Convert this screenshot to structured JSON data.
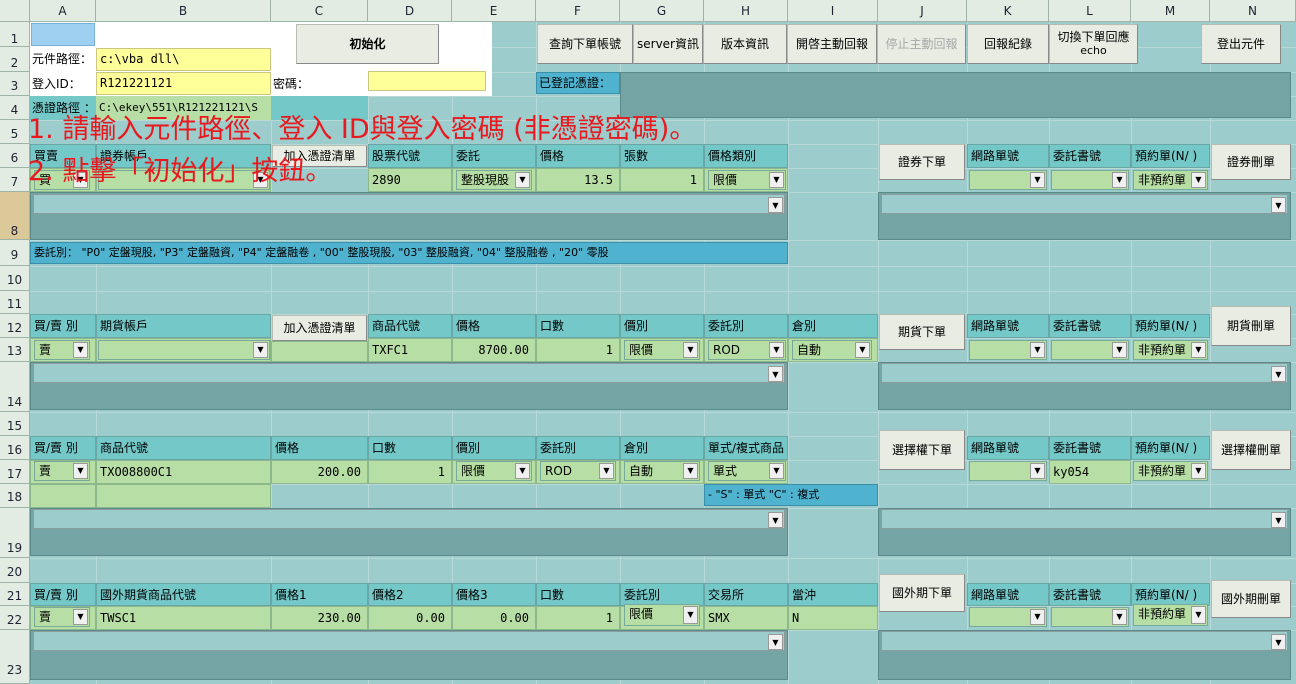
{
  "columns": [
    "A",
    "B",
    "C",
    "D",
    "E",
    "F",
    "G",
    "H",
    "I",
    "J",
    "K",
    "L",
    "M",
    "N"
  ],
  "rows": [
    "1",
    "2",
    "3",
    "4",
    "5",
    "6",
    "7",
    "8",
    "9",
    "10",
    "11",
    "12",
    "13",
    "14",
    "15",
    "16",
    "17",
    "18",
    "19",
    "20",
    "21",
    "22",
    "23"
  ],
  "login": {
    "component_path_label": "元件路徑：",
    "component_path_value": "c:\\vba dll\\",
    "login_id_label": "登入ID：",
    "login_id_value": "R121221121",
    "password_label": "密碼：",
    "password_value": "",
    "cert_path_label": "憑證路徑 ：",
    "cert_path_value": "C:\\ekey\\551\\R121221121\\S",
    "init_button": "初始化"
  },
  "toolbar": {
    "query_account": "查詢下單帳號",
    "server_info": "server資訊",
    "version_info": "版本資訊",
    "start_callback": "開啓主動回報",
    "stop_callback": "停止主動回報",
    "callback_log": "回報紀錄",
    "switch_echo_line1": "切換下單回應",
    "switch_echo_line2": "echo",
    "logout": "登出元件"
  },
  "registered_cert_label": "已登記憑證：",
  "instructions": {
    "line1": "1. 請輸入元件路徑、登入 ID與登入密碼 (非憑證密碼)。",
    "line2": "2. 點擊「初始化」按鈕。"
  },
  "stock": {
    "headers": {
      "buysell": "買賣",
      "account": "證券帳戶",
      "code": "股票代號",
      "order_type": "委託",
      "price": "價格",
      "qty": "張數",
      "price_type": "價格類別"
    },
    "add_cert_button": "加入憑證清單",
    "values": {
      "buysell": "買",
      "code": "2890",
      "order_type": "整股現股",
      "price": "13.5",
      "qty": "1",
      "price_type": "限價"
    },
    "order_button": "證券下單",
    "delete_button": "證券刪單",
    "note": "委託別：  \"P0\" 定盤現股, \"P3\" 定盤融資, \"P4\" 定盤融卷 , \"00\" 整股現股, \"03\" 整股融資, \"04\" 整股融卷 , \"20\" 零股"
  },
  "right_headers": {
    "net_no": "網路單號",
    "book_no": "委託書號",
    "reserve": "預約單(N/ )"
  },
  "reserve_value": "非預約單",
  "futures": {
    "headers": {
      "buysell": "買/賣 別",
      "account": "期貨帳戶",
      "code": "商品代號",
      "price": "價格",
      "qty": "口數",
      "price_kind": "價別",
      "order_kind": "委託別",
      "position": "倉別"
    },
    "add_cert_button": "加入憑證清單",
    "values": {
      "buysell": "賣",
      "code": "TXFC1",
      "price": "8700.00",
      "qty": "1",
      "price_kind": "限價",
      "order_kind": "ROD",
      "position": "自動"
    },
    "order_button": "期貨下單",
    "delete_button": "期貨刪單"
  },
  "options": {
    "headers": {
      "buysell": "買/賣 別",
      "code": "商品代號",
      "price": "價格",
      "qty": "口數",
      "price_kind": "價別",
      "order_kind": "委託別",
      "position": "倉別",
      "single_combo": "單式/複式商品"
    },
    "values": {
      "buysell": "賣",
      "code": "TXO08800C1",
      "price": "200.00",
      "qty": "1",
      "price_kind": "限價",
      "order_kind": "ROD",
      "position": "自動",
      "single_combo": "單式"
    },
    "note": "- \"S\" : 單式          \"C\" : 複式",
    "order_button": "選擇權下單",
    "delete_button": "選擇權刪單",
    "book_no_value": "ky054"
  },
  "foreign": {
    "headers": {
      "buysell": "買/賣 別",
      "code": "國外期貨商品代號",
      "price1": "價格1",
      "price2": "價格2",
      "price3": "價格3",
      "qty": "口數",
      "order_kind": "委託別",
      "exchange": "交易所",
      "daytrade": "當沖"
    },
    "values": {
      "buysell": "賣",
      "code": "TWSC1",
      "price1": "230.00",
      "price2": "0.00",
      "price3": "0.00",
      "qty": "1",
      "exchange": "SMX",
      "daytrade": "N"
    },
    "order_button": "國外期下單",
    "delete_button": "國外期刪單"
  },
  "icons": {
    "dropdown": "chevron-down-icon"
  }
}
